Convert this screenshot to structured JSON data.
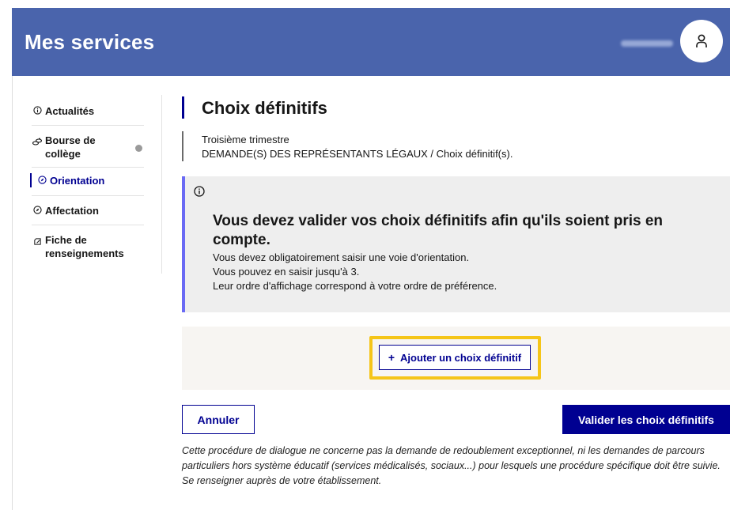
{
  "header": {
    "app_title": "Mes services"
  },
  "sidebar": {
    "items": [
      {
        "label": "Actualités",
        "icon": "info-circle-icon"
      },
      {
        "label": "Bourse de\ncollège",
        "icon": "coins-icon"
      },
      {
        "label": "Orientation",
        "icon": "compass-icon",
        "active": true
      },
      {
        "label": "Affectation",
        "icon": "compass-icon"
      },
      {
        "label": "Fiche de\nrenseignements",
        "icon": "edit-icon"
      }
    ]
  },
  "page": {
    "title": "Choix définitifs",
    "subtitle_period": "Troisième trimestre",
    "subtitle_path": "DEMANDE(S) DES REPRÉSENTANTS LÉGAUX / Choix définitif(s)."
  },
  "alert": {
    "title": "Vous devez valider vos choix définitifs afin qu'ils soient pris en compte.",
    "lines": [
      "Vous devez obligatoirement saisir une voie d'orientation.",
      "Vous pouvez en saisir jusqu'à 3.",
      "Leur ordre d'affichage correspond à votre ordre de préférence."
    ]
  },
  "actions": {
    "add_label": "Ajouter un choix définitif",
    "cancel_label": "Annuler",
    "validate_label": "Valider les choix définitifs"
  },
  "notice": "Cette procédure de dialogue ne concerne pas la demande de redoublement exceptionnel, ni les demandes de parcours particuliers hors système éducatif (services médicalisés, sociaux...) pour lesquels une procédure spécifique doit être suivie. Se renseigner auprès de votre établissement.",
  "colors": {
    "header_bg": "#4a64ac",
    "primary": "#000091",
    "alert_accent": "#6a6af4",
    "highlight": "#f5c518"
  }
}
